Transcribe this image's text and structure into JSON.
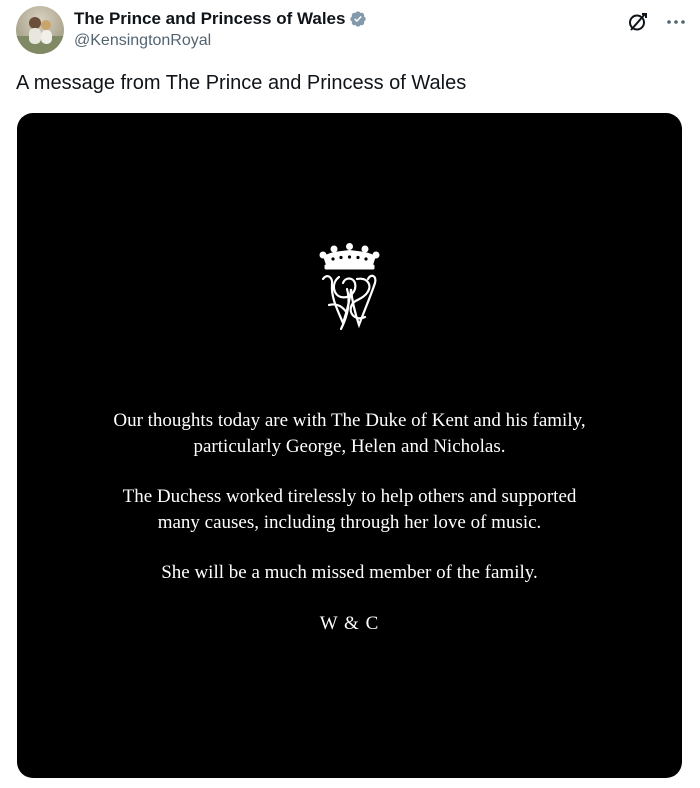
{
  "account": {
    "display_name": "The Prince and Princess of Wales",
    "handle": "@KensingtonRoyal",
    "verified_color": "#829aab"
  },
  "icons": {
    "avatar": "profile-photo",
    "verified": "verified-badge-icon",
    "grok": "grok-icon",
    "more": "more-icon",
    "cypher": "royal-cypher-crown-monogram"
  },
  "tweet": {
    "text": "A message from The Prince and Princess of Wales"
  },
  "media": {
    "background": "#000000",
    "lines_1": [
      "Our thoughts today are with The Duke of Kent and his family,",
      "particularly George, Helen and Nicholas."
    ],
    "lines_2": [
      "The Duchess worked tirelessly to help others and supported",
      "many causes, including through her love of music."
    ],
    "line_3": "She will be a much missed member of the family.",
    "signature": "W & C"
  }
}
